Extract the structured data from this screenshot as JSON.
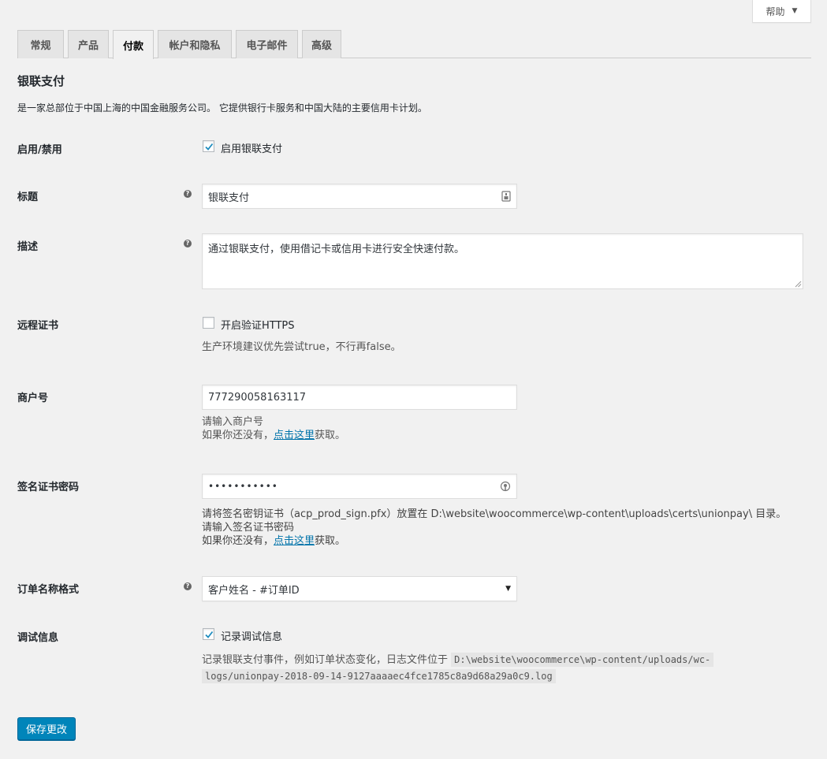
{
  "help": {
    "label": "帮助",
    "caret": "▼"
  },
  "tabs": [
    {
      "label": "常规"
    },
    {
      "label": "产品"
    },
    {
      "label": "付款"
    },
    {
      "label": "帐户和隐私"
    },
    {
      "label": "电子邮件"
    },
    {
      "label": "高级"
    }
  ],
  "active_tab": "付款",
  "section": {
    "title": "银联支付",
    "intro": "是一家总部位于中国上海的中国金融服务公司。 它提供银行卡服务和中国大陆的主要信用卡计划。"
  },
  "fields": {
    "enable": {
      "label": "启用/禁用",
      "checkbox_label": "启用银联支付",
      "checked": true
    },
    "title": {
      "label": "标题",
      "value": "银联支付"
    },
    "description": {
      "label": "描述",
      "value": "通过银联支付，使用借记卡或信用卡进行安全快速付款。"
    },
    "remote_cert": {
      "label": "远程证书",
      "checkbox_label": "开启验证HTTPS",
      "checked": false,
      "desc": "生产环境建议优先尝试true，不行再false。"
    },
    "merchant_id": {
      "label": "商户号",
      "value": "777290058163117",
      "desc1": "请输入商户号",
      "desc2_pre": "如果你还没有，",
      "desc2_link": "点击这里",
      "desc2_post": "获取。"
    },
    "cert_password": {
      "label": "签名证书密码",
      "value": "•••••••••••",
      "desc1": "请将签名密钥证书（acp_prod_sign.pfx）放置在 D:\\website\\woocommerce\\wp-content\\uploads\\certs\\unionpay\\ 目录。",
      "desc2": "请输入签名证书密码",
      "desc3_pre": "如果你还没有，",
      "desc3_link": "点击这里",
      "desc3_post": "获取。"
    },
    "order_name_format": {
      "label": "订单名称格式",
      "value": "客户姓名 - #订单ID"
    },
    "debug": {
      "label": "调试信息",
      "checkbox_label": "记录调试信息",
      "checked": true,
      "desc_pre": "记录银联支付事件，例如订单状态变化，日志文件位于",
      "desc_code1": "D:\\website\\woocommerce\\wp-content/uploads/wc-",
      "desc_code2": "logs/unionpay-2018-09-14-9127aaaaec4fce1785c8a9d68a29a0c9.log"
    }
  },
  "save_label": "保存更改",
  "colors": {
    "primary": "#0085ba",
    "link": "#0073aa",
    "background": "#f1f1f1"
  }
}
